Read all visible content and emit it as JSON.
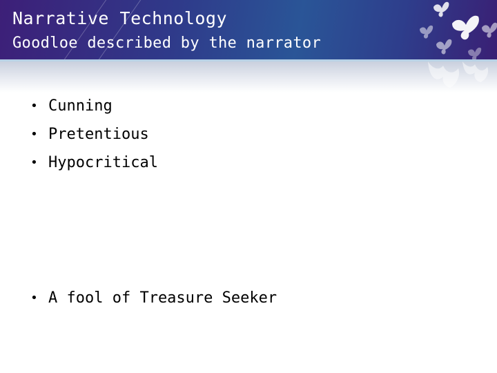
{
  "slide": {
    "title": "Narrative Technology",
    "subtitle": "Goodloe described by the narrator",
    "bullets": [
      {
        "marker": "•",
        "text": "Cunning"
      },
      {
        "marker": "•",
        "text": "Pretentious"
      },
      {
        "marker": "•",
        "text": "Hypocritical"
      }
    ],
    "bullets_lower": [
      {
        "marker": "•",
        "text": "A fool of Treasure Seeker"
      }
    ]
  },
  "theme": {
    "header_color_dark": "#3d1f78",
    "header_color_mid": "#2a5597",
    "accent_line": "#b8d2e6",
    "text_color": "#000000",
    "title_color": "#ffffff",
    "decoration": "butterflies-icon"
  }
}
